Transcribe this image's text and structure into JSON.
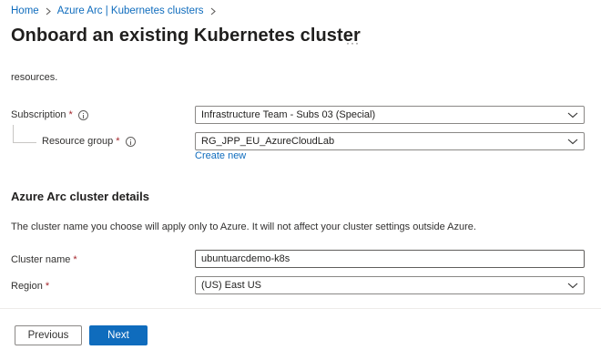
{
  "breadcrumb": {
    "items": [
      "Home",
      "Azure Arc | Kubernetes clusters"
    ]
  },
  "header": {
    "title": "Onboard an existing Kubernetes cluster",
    "more_label": "···"
  },
  "intro": {
    "clipped_text": "resources."
  },
  "project": {
    "subscription": {
      "label": "Subscription",
      "required": "*",
      "value": "Infrastructure Team - Subs 03 (Special)"
    },
    "resource_group": {
      "label": "Resource group",
      "required": "*",
      "value": "RG_JPP_EU_AzureCloudLab",
      "create_new": "Create new"
    }
  },
  "cluster_details": {
    "title": "Azure Arc cluster details",
    "description": "The cluster name you choose will apply only to Azure. It will not affect your cluster settings outside Azure.",
    "cluster_name": {
      "label": "Cluster name",
      "required": "*",
      "value": "ubuntuarcdemo-k8s"
    },
    "region": {
      "label": "Region",
      "required": "*",
      "value": "(US) East US"
    }
  },
  "footer": {
    "previous_label": "Previous",
    "next_label": "Next"
  },
  "colors": {
    "accent": "#0f6cbd",
    "required": "#a4262c"
  }
}
